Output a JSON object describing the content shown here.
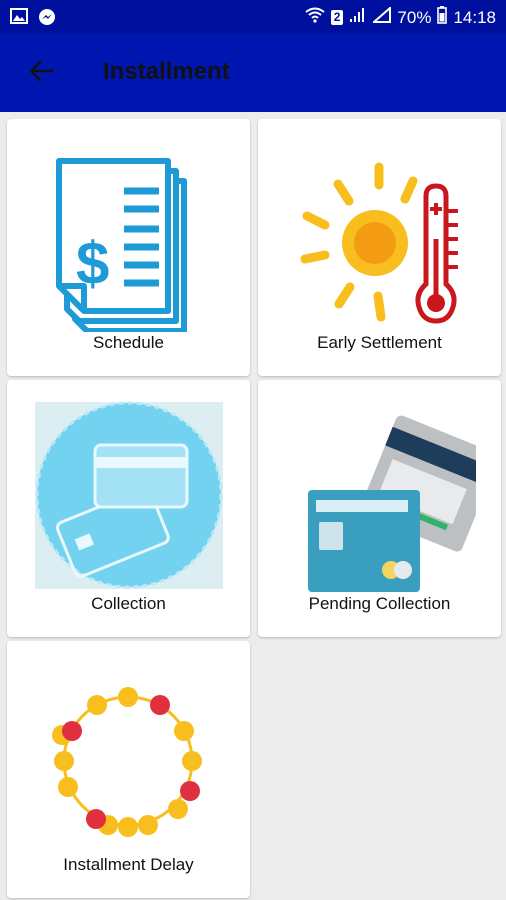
{
  "status_bar": {
    "battery": "70%",
    "time": "14:18",
    "notification_badge": "2"
  },
  "app_bar": {
    "title": "Installment",
    "back_icon": "arrow-left-icon"
  },
  "menu": {
    "items": [
      {
        "label": "Schedule",
        "icon": "invoice-dollar-icon"
      },
      {
        "label": "Early Settlement",
        "icon": "sun-thermometer-icon"
      },
      {
        "label": "Collection",
        "icon": "credit-card-icon"
      },
      {
        "label": "Pending Collection",
        "icon": "stacked-cards-icon"
      },
      {
        "label": "Installment Delay",
        "icon": "bead-ring-icon"
      }
    ]
  },
  "colors": {
    "status_bar": "#00109e",
    "app_bar": "#0016b0",
    "background": "#ececec",
    "card": "#ffffff"
  }
}
